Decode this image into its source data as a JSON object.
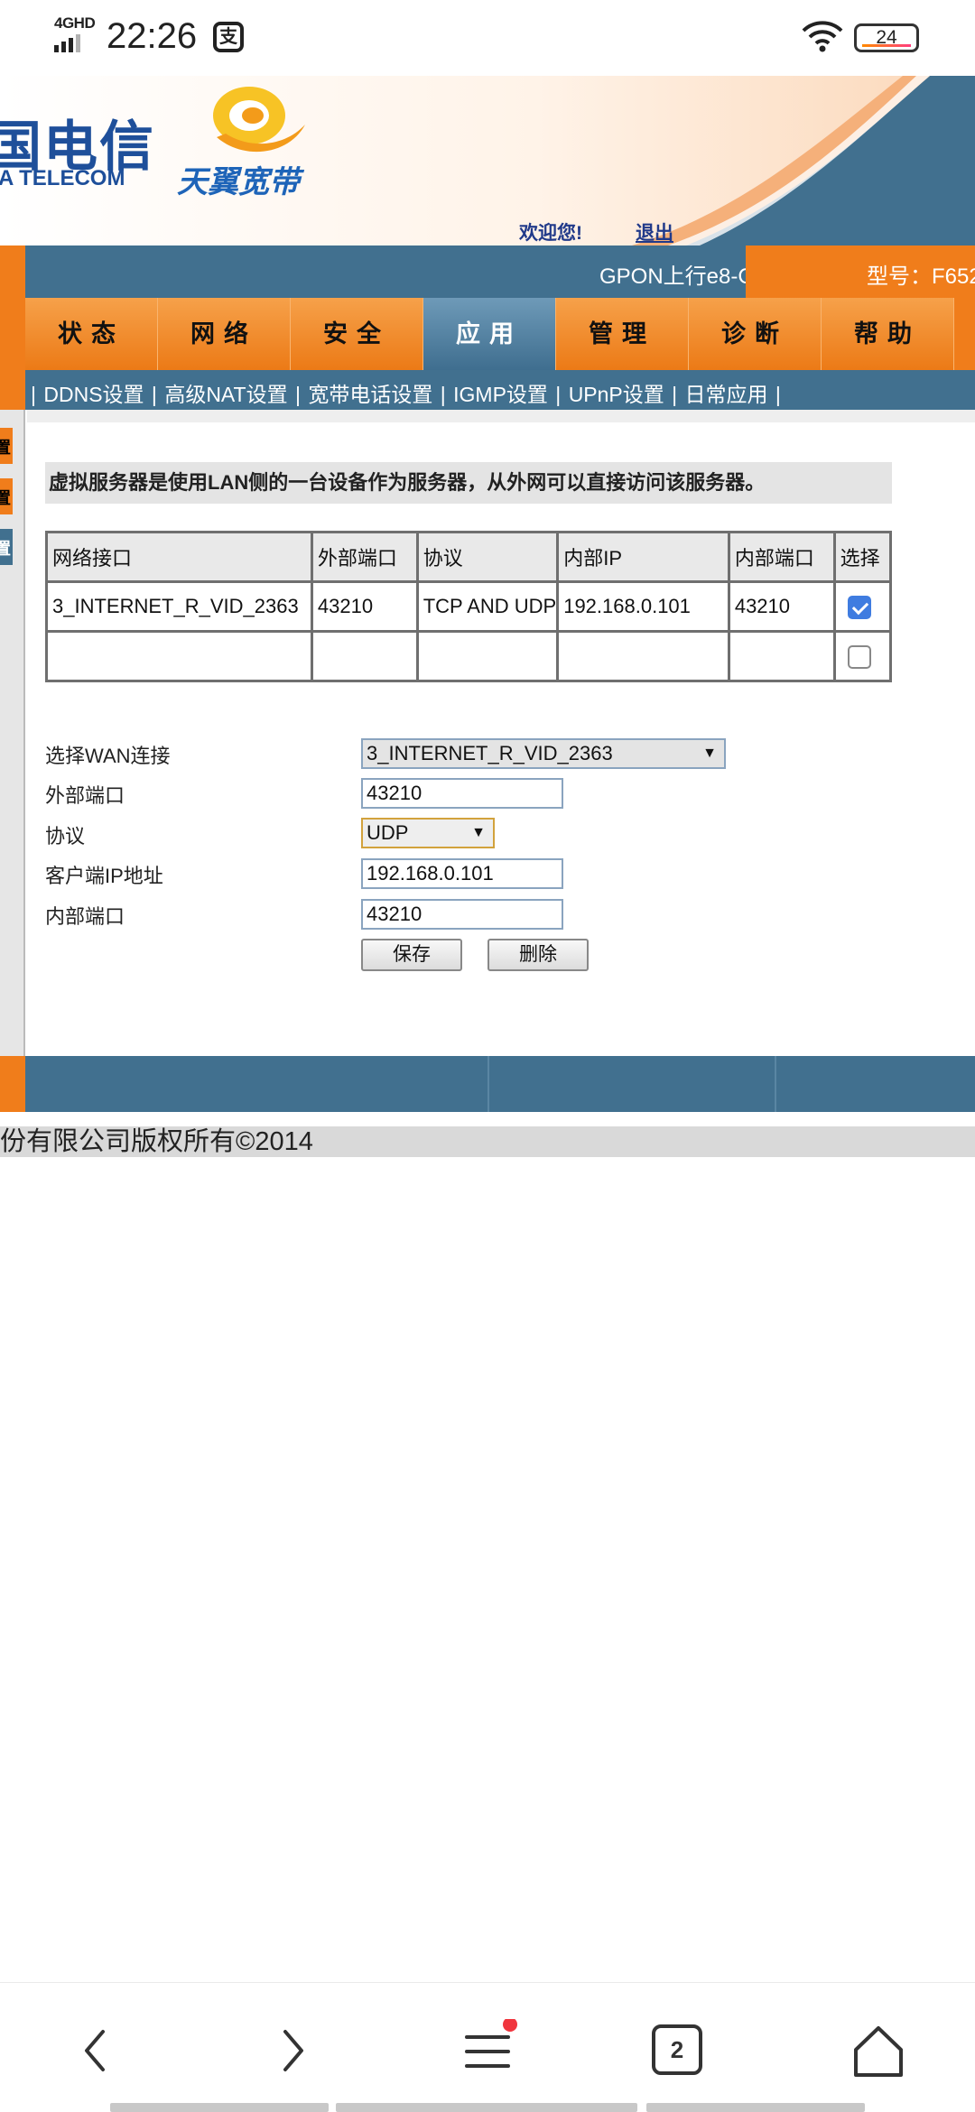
{
  "status_bar": {
    "network": "4GHD",
    "time": "22:26",
    "app_badge": "支",
    "battery": "24"
  },
  "header": {
    "logo_cn": "国电信",
    "logo_en": "A TELECOM",
    "logo_brand": "天翼宽带",
    "welcome": "欢迎您!",
    "logout": "退出"
  },
  "model_bar": {
    "device": "GPON上行e8-C",
    "model": "型号：F652"
  },
  "menu": {
    "items": [
      {
        "label": "状态"
      },
      {
        "label": "网络"
      },
      {
        "label": "安全"
      },
      {
        "label": "应用"
      },
      {
        "label": "管理"
      },
      {
        "label": "诊断"
      },
      {
        "label": "帮助"
      }
    ],
    "active": "应用"
  },
  "submenu": {
    "items": [
      "DDNS设置",
      "高级NAT设置",
      "宽带电话设置",
      "IGMP设置",
      "UPnP设置",
      "日常应用"
    ]
  },
  "sidebar": {
    "tabs": [
      "置",
      "置",
      "置"
    ]
  },
  "content": {
    "description": "虚拟服务器是使用LAN侧的一台设备作为服务器，从外网可以直接访问该服务器。",
    "table": {
      "headers": [
        "网络接口",
        "外部端口",
        "协议",
        "内部IP",
        "内部端口",
        "选择"
      ],
      "rows": [
        {
          "iface": "3_INTERNET_R_VID_2363",
          "ext_port": "43210",
          "protocol": "TCP AND UDP",
          "int_ip": "192.168.0.101",
          "int_port": "43210",
          "selected": true
        },
        {
          "iface": "",
          "ext_port": "",
          "protocol": "",
          "int_ip": "",
          "int_port": "",
          "selected": false
        }
      ]
    },
    "form": {
      "wan_label": "选择WAN连接",
      "wan_value": "3_INTERNET_R_VID_2363",
      "ext_port_label": "外部端口",
      "ext_port_value": "43210",
      "protocol_label": "协议",
      "protocol_value": "UDP",
      "client_ip_label": "客户端IP地址",
      "client_ip_value": "192.168.0.101",
      "int_port_label": "内部端口",
      "int_port_value": "43210",
      "save_label": "保存",
      "delete_label": "删除"
    }
  },
  "footer": {
    "copyright": "份有限公司版权所有©2014"
  },
  "browser_nav": {
    "tabs_count": "2"
  },
  "colors": {
    "orange": "#f07d1b",
    "steel_blue": "#41708f",
    "telecom_blue": "#1e4f9a",
    "checkbox_blue": "#3f7ce0"
  }
}
